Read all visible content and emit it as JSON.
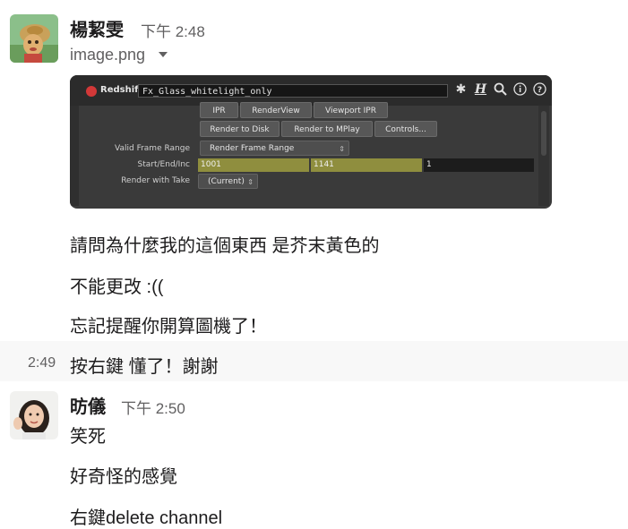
{
  "messages": [
    {
      "sender": "楊絜雯",
      "time": "下午 2:48",
      "attachment": {
        "file_name": "image.png",
        "dropdown_icon": "caret-down-icon",
        "screenshot": {
          "app_label": "Redshift",
          "node_name": "Fx_Glass_whitelight_only",
          "toolbar_icons": [
            "gear-icon",
            "help-h-icon",
            "search-icon",
            "info-icon",
            "question-icon"
          ],
          "buttons_row1": [
            "IPR",
            "RenderView",
            "Viewport IPR"
          ],
          "buttons_row2": [
            "Render to Disk",
            "Render to MPlay",
            "Controls..."
          ],
          "valid_frame_range_label": "Valid Frame Range",
          "valid_frame_range_value": "Render Frame Range",
          "start_end_inc_label": "Start/End/Inc",
          "start_value": "1001",
          "end_value": "1141",
          "inc_value": "1",
          "render_with_take_label": "Render with Take",
          "render_with_take_value": "(Current)",
          "accent_color": "#8f8e3e"
        }
      },
      "lines": [
        "請問為什麼我的這個東西 是芥末黃色的",
        "不能更改 :((",
        "忘記提醒你開算圖機了！"
      ]
    },
    {
      "hover_time": "2:49",
      "text": "按右鍵 懂了！謝謝"
    },
    {
      "sender": "昉儀",
      "time": "下午 2:50",
      "lines": [
        "笑死",
        "好奇怪的感覺",
        "右鍵delete channel"
      ]
    }
  ]
}
